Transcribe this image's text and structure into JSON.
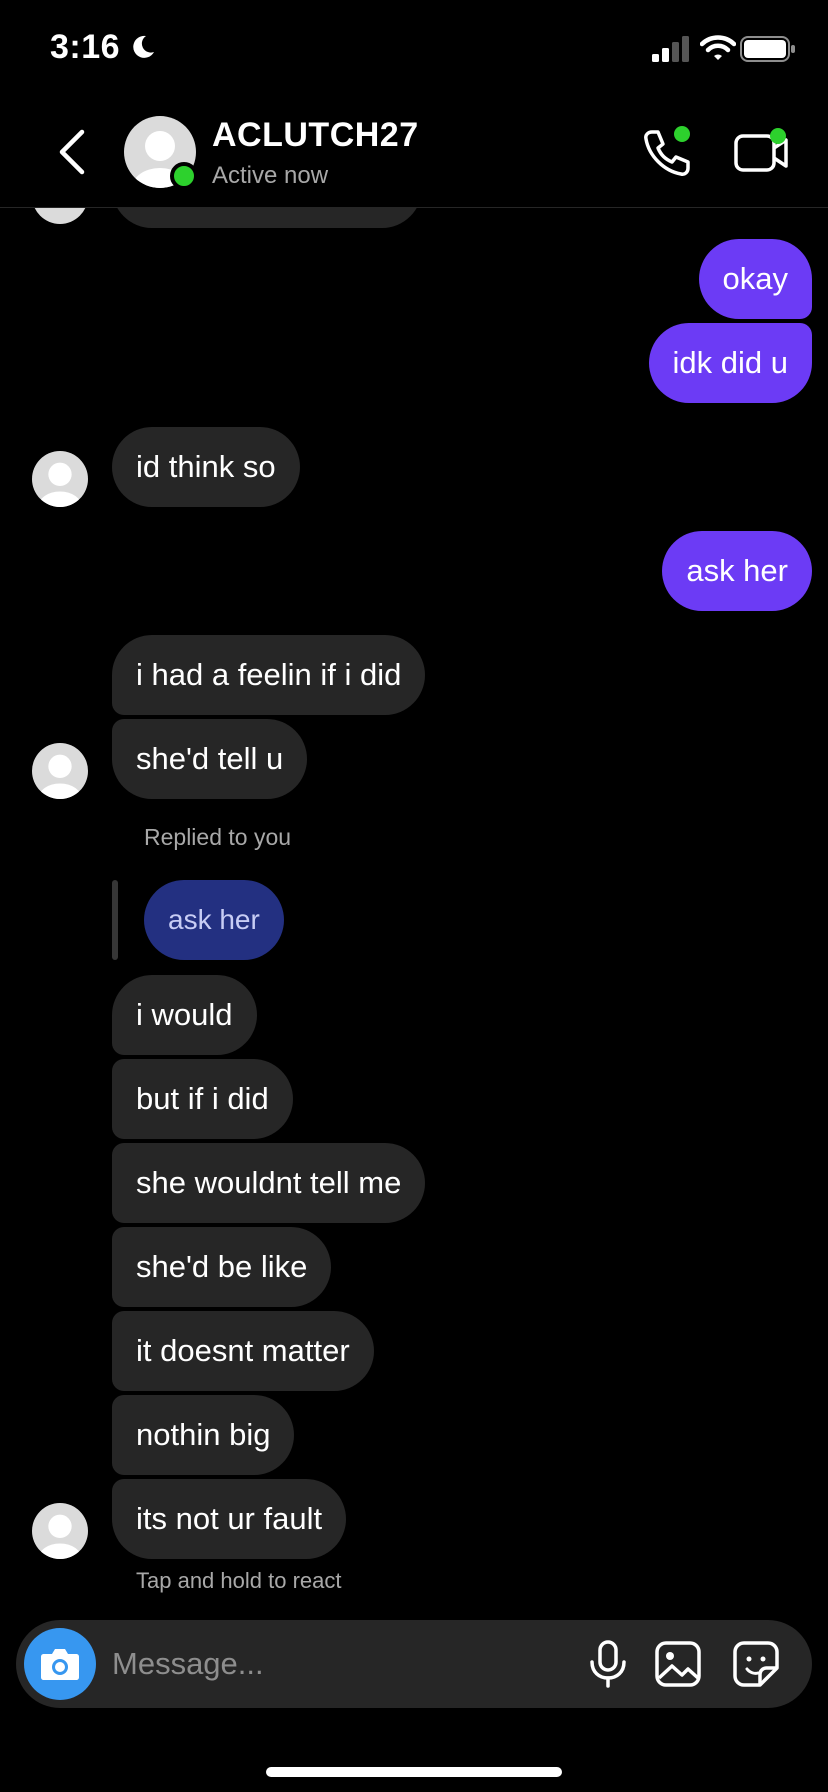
{
  "status_bar": {
    "time": "3:16",
    "moon_icon": "moon-icon",
    "signal_icon": "cellular-signal-icon",
    "wifi_icon": "wifi-icon",
    "battery_icon": "battery-icon"
  },
  "header": {
    "contact_name": "ACLUTCH27",
    "contact_status": "Active now",
    "back_icon": "chevron-left-icon",
    "call_icon": "phone-icon",
    "video_icon": "video-camera-icon",
    "online_color": "#2dd12d"
  },
  "messages": [
    {
      "from": "me",
      "text": "okay"
    },
    {
      "from": "me",
      "text": "idk did u"
    },
    {
      "from": "them",
      "text": "id think so"
    },
    {
      "from": "me",
      "text": "ask her"
    },
    {
      "from": "them",
      "text": "i had a feelin if i did"
    },
    {
      "from": "them",
      "text": "she'd tell u"
    },
    {
      "from": "them",
      "reply_label": "Replied to you",
      "quoted_text": "ask her"
    },
    {
      "from": "them",
      "text": "i would"
    },
    {
      "from": "them",
      "text": "but if i did"
    },
    {
      "from": "them",
      "text": "she wouldnt tell me"
    },
    {
      "from": "them",
      "text": "she'd be like"
    },
    {
      "from": "them",
      "text": "it doesnt matter"
    },
    {
      "from": "them",
      "text": "nothin big"
    },
    {
      "from": "them",
      "text": "its not ur fault"
    }
  ],
  "hint": "Tap and hold to react",
  "composer": {
    "placeholder": "Message...",
    "camera_icon": "camera-icon",
    "mic_icon": "microphone-icon",
    "gallery_icon": "gallery-icon",
    "sticker_icon": "sticker-icon"
  },
  "colors": {
    "outgoing_bubble": "#6c3bf5",
    "incoming_bubble": "#262626",
    "quoted_bubble": "#233081",
    "camera_button": "#3797f0"
  }
}
